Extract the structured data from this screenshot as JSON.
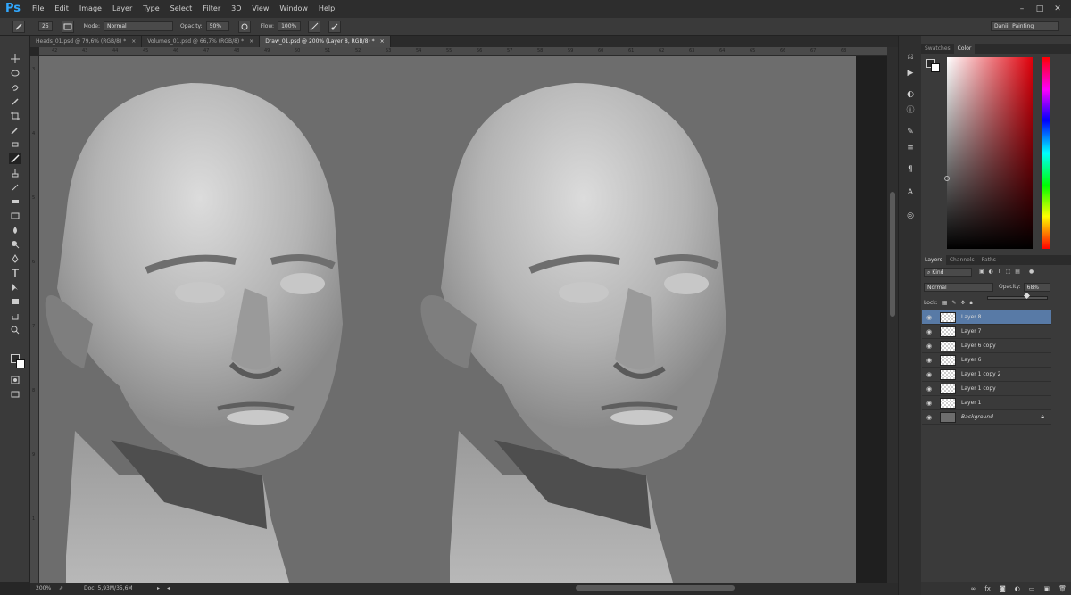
{
  "app": {
    "logo": "Ps"
  },
  "menu": [
    "File",
    "Edit",
    "Image",
    "Layer",
    "Type",
    "Select",
    "Filter",
    "3D",
    "View",
    "Window",
    "Help"
  ],
  "window_controls": [
    "–",
    "□",
    "✕"
  ],
  "options_bar": {
    "brush_size": "25",
    "mode_label": "Mode:",
    "mode_value": "Normal",
    "opacity_label": "Opacity:",
    "opacity_value": "50%",
    "flow_label": "Flow:",
    "flow_value": "100%",
    "workspace": "Daniil_Painting"
  },
  "tabs": [
    {
      "label": "Heads_01.psd @ 79,6% (RGB/8) *",
      "close": "×"
    },
    {
      "label": "Volumes_01.psd @ 66,7% (RGB/8) *",
      "close": "×"
    },
    {
      "label": "Draw_01.psd @ 200% (Layer 8, RGB/8) *",
      "close": "×"
    }
  ],
  "ruler": {
    "top": [
      "42",
      "43",
      "44",
      "45",
      "46",
      "47",
      "48",
      "49",
      "50",
      "51",
      "52",
      "53",
      "54",
      "55",
      "56",
      "57",
      "58",
      "59",
      "60",
      "61",
      "62",
      "63",
      "64",
      "65",
      "66",
      "67",
      "68"
    ],
    "left": [
      "3",
      "4",
      "5",
      "6",
      "7",
      "8",
      "9",
      "1"
    ]
  },
  "status": {
    "zoom": "200%",
    "doc": "Doc: 5,93M/35,6M"
  },
  "panels": {
    "color_tabs": [
      "Swatches",
      "Color"
    ],
    "layer_tabs": [
      "Layers",
      "Channels",
      "Paths"
    ],
    "kind_label": "Kind",
    "blend_mode": "Normal",
    "opacity_label": "Opacity:",
    "opacity_value": "68%",
    "lock_label": "Lock:",
    "colors": {
      "foreground": "#2a2a2a",
      "background": "#ffffff",
      "selected_row": "#587aa6"
    }
  },
  "layers": [
    {
      "name": "Layer 8",
      "selected": true
    },
    {
      "name": "Layer 7"
    },
    {
      "name": "Layer 6 copy"
    },
    {
      "name": "Layer 6"
    },
    {
      "name": "Layer 1 copy 2"
    },
    {
      "name": "Layer 1 copy"
    },
    {
      "name": "Layer 1"
    },
    {
      "name": "Background",
      "locked": true
    }
  ],
  "icons": {
    "eye": "eye-icon",
    "lock": "lock-icon"
  }
}
